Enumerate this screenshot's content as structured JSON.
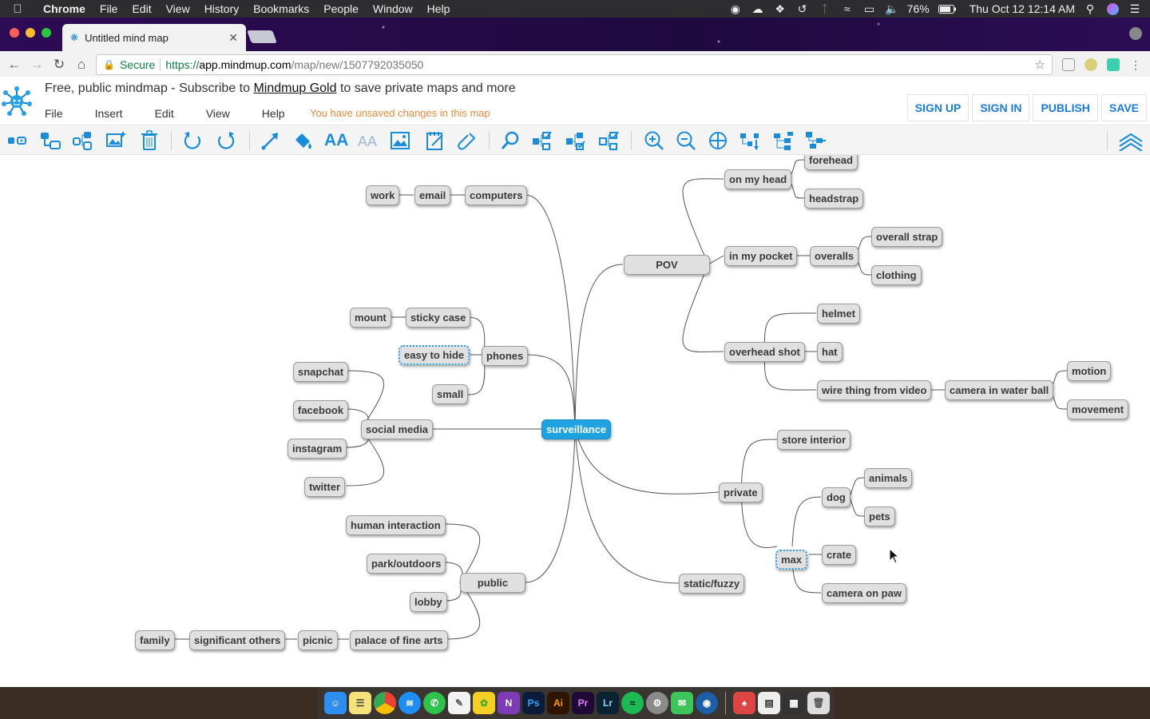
{
  "mac_menubar": {
    "app_name": "Chrome",
    "menus": [
      "File",
      "Edit",
      "View",
      "History",
      "Bookmarks",
      "People",
      "Window",
      "Help"
    ],
    "battery": "76%",
    "clock": "Thu Oct 12  12:14 AM"
  },
  "browser": {
    "tab_title": "Untitled mind map",
    "secure_label": "Secure",
    "url_scheme": "https://",
    "url_host": "app.mindmup.com",
    "url_path": "/map/new/1507792035050"
  },
  "app": {
    "promo_prefix": "Free, public mindmap - Subscribe to ",
    "promo_link": "Mindmup Gold",
    "promo_suffix": " to save private maps and more",
    "menu": [
      "File",
      "Insert",
      "Edit",
      "View",
      "Help"
    ],
    "unsaved_notice": "You have unsaved changes in this map",
    "buttons": {
      "sign_up": "SIGN UP",
      "sign_in": "SIGN IN",
      "publish": "PUBLISH",
      "save": "SAVE"
    }
  },
  "mind_map": {
    "root": "surveillance",
    "nodes": {
      "work": "work",
      "email": "email",
      "computers": "computers",
      "mount": "mount",
      "sticky_case": "sticky case",
      "easy_to_hide": "easy to hide",
      "phones": "phones",
      "small": "small",
      "snapchat": "snapchat",
      "facebook": "facebook",
      "instagram": "instagram",
      "twitter": "twitter",
      "social_media": "social media",
      "human_interaction": "human interaction",
      "park_outdoors": "park/outdoors",
      "lobby": "lobby",
      "public": "public",
      "palace": "palace of fine arts",
      "picnic": "picnic",
      "significant_others": "significant others",
      "family": "family",
      "pov": "POV",
      "on_my_head": "on my head",
      "forehead": "forehead",
      "headstrap": "headstrap",
      "in_my_pocket": "in my pocket",
      "overalls": "overalls",
      "overall_strap": "overall strap",
      "clothing": "clothing",
      "overhead_shot": "overhead shot",
      "helmet": "helmet",
      "hat": "hat",
      "wire_thing": "wire thing from video",
      "camera_ball": "camera in water ball",
      "motion": "motion",
      "movement": "movement",
      "private": "private",
      "store_interior": "store interior",
      "max": "max",
      "dog": "dog",
      "animals": "animals",
      "pets": "pets",
      "crate": "crate",
      "camera_on_paw": "camera on paw",
      "static_fuzzy": "static/fuzzy"
    }
  },
  "dock_apps": [
    "Finder",
    "Notes",
    "Chrome",
    "Messenger",
    "WhatsApp",
    "TextEdit",
    "Wunderlist",
    "OneNote",
    "Ps",
    "Ai",
    "Pr",
    "Lr",
    "Spotify",
    "System Preferences",
    "Messages",
    "Migration",
    "Preview",
    "Documents",
    "Screens",
    "Trash"
  ]
}
